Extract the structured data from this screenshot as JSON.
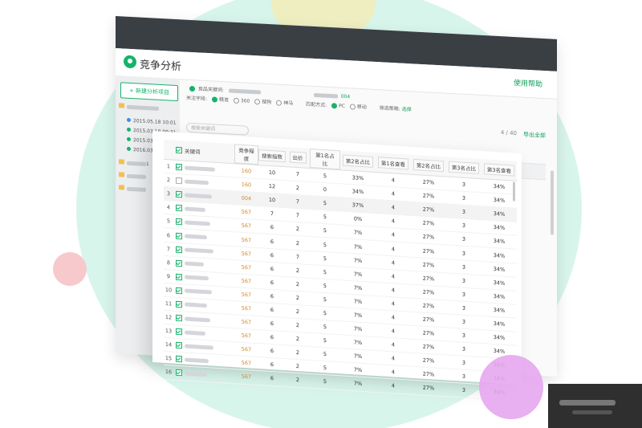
{
  "colors": {
    "accent": "#16b36a",
    "mint": "#d8f5ec",
    "titlebar": "#3a3f44",
    "search_col": "#d38a2c"
  },
  "back_window": {
    "app_title": "竞争分析",
    "help_link": "使用帮助",
    "new_button": "+ 新建分析项目",
    "tree": [
      {
        "kind": "group",
        "label": ""
      },
      {
        "kind": "time",
        "label": "2015.05.18 10:01"
      },
      {
        "kind": "time",
        "label": "2015.03.18 09:31"
      },
      {
        "kind": "time",
        "label": "2015.03.18 10:01"
      },
      {
        "kind": "time",
        "label": "2016.03.18 09:31"
      },
      {
        "kind": "folder",
        "label": "1"
      },
      {
        "kind": "folder",
        "label": ""
      },
      {
        "kind": "folder",
        "label": ""
      }
    ],
    "filter1_label": "竞品关键词:",
    "filter1_tag": "004",
    "filter2_label": "关注字段:",
    "filter2_opts": [
      "精准",
      "360",
      "搜狗",
      "神马"
    ],
    "filter3_label": "匹配方式:",
    "filter3_opts": [
      "PC",
      "移动"
    ],
    "filter4_label": "筛选策略:",
    "filter4_link": "选择",
    "search_placeholder": "搜索关键词",
    "count": "4 / 40",
    "export": "导出全部",
    "headers": [
      "关键词",
      "竞争程度",
      "搜索指数",
      "出价",
      "第1名占比",
      "第2名占比",
      "第3名占比",
      "第1名查看",
      "第2名占比"
    ]
  },
  "table": {
    "headers": [
      "关键词",
      "竞争程度",
      "搜索指数",
      "出价",
      "第1名占比",
      "第2名占比",
      "第1名查看",
      "第2名占比",
      "第3名占比",
      "第3名查看"
    ],
    "rows": [
      {
        "n": "1",
        "checked": true,
        "search": "160",
        "c1": "10",
        "c2": "7",
        "c3": "5",
        "p1": "33%",
        "q1": "4",
        "p2": "27%",
        "q2": "3",
        "p3": "34%",
        "hl": false
      },
      {
        "n": "2",
        "checked": false,
        "search": "160",
        "c1": "12",
        "c2": "2",
        "c3": "0",
        "p1": "34%",
        "q1": "4",
        "p2": "27%",
        "q2": "3",
        "p3": "34%",
        "hl": false
      },
      {
        "n": "3",
        "checked": true,
        "search": "004",
        "c1": "10",
        "c2": "7",
        "c3": "5",
        "p1": "37%",
        "q1": "4",
        "p2": "27%",
        "q2": "3",
        "p3": "34%",
        "hl": true
      },
      {
        "n": "4",
        "checked": true,
        "search": "567",
        "c1": "7",
        "c2": "7",
        "c3": "5",
        "p1": "0%",
        "q1": "4",
        "p2": "27%",
        "q2": "3",
        "p3": "34%",
        "hl": false
      },
      {
        "n": "5",
        "checked": true,
        "search": "567",
        "c1": "6",
        "c2": "2",
        "c3": "5",
        "p1": "7%",
        "q1": "4",
        "p2": "27%",
        "q2": "3",
        "p3": "34%",
        "hl": false
      },
      {
        "n": "6",
        "checked": true,
        "search": "567",
        "c1": "6",
        "c2": "2",
        "c3": "5",
        "p1": "7%",
        "q1": "4",
        "p2": "27%",
        "q2": "3",
        "p3": "34%",
        "hl": false
      },
      {
        "n": "7",
        "checked": true,
        "search": "567",
        "c1": "6",
        "c2": "7",
        "c3": "5",
        "p1": "7%",
        "q1": "4",
        "p2": "27%",
        "q2": "3",
        "p3": "34%",
        "hl": false
      },
      {
        "n": "8",
        "checked": true,
        "search": "567",
        "c1": "6",
        "c2": "2",
        "c3": "5",
        "p1": "7%",
        "q1": "4",
        "p2": "27%",
        "q2": "3",
        "p3": "34%",
        "hl": false
      },
      {
        "n": "9",
        "checked": true,
        "search": "567",
        "c1": "6",
        "c2": "2",
        "c3": "5",
        "p1": "7%",
        "q1": "4",
        "p2": "27%",
        "q2": "3",
        "p3": "34%",
        "hl": false
      },
      {
        "n": "10",
        "checked": true,
        "search": "567",
        "c1": "6",
        "c2": "2",
        "c3": "5",
        "p1": "7%",
        "q1": "4",
        "p2": "27%",
        "q2": "3",
        "p3": "34%",
        "hl": false
      },
      {
        "n": "11",
        "checked": true,
        "search": "567",
        "c1": "6",
        "c2": "2",
        "c3": "5",
        "p1": "7%",
        "q1": "4",
        "p2": "27%",
        "q2": "3",
        "p3": "34%",
        "hl": false
      },
      {
        "n": "12",
        "checked": true,
        "search": "567",
        "c1": "6",
        "c2": "2",
        "c3": "5",
        "p1": "7%",
        "q1": "4",
        "p2": "27%",
        "q2": "3",
        "p3": "34%",
        "hl": false
      },
      {
        "n": "13",
        "checked": true,
        "search": "567",
        "c1": "6",
        "c2": "2",
        "c3": "5",
        "p1": "7%",
        "q1": "4",
        "p2": "27%",
        "q2": "3",
        "p3": "34%",
        "hl": false
      },
      {
        "n": "14",
        "checked": true,
        "search": "567",
        "c1": "6",
        "c2": "2",
        "c3": "5",
        "p1": "7%",
        "q1": "4",
        "p2": "27%",
        "q2": "3",
        "p3": "34%",
        "hl": false
      },
      {
        "n": "15",
        "checked": true,
        "search": "567",
        "c1": "6",
        "c2": "2",
        "c3": "5",
        "p1": "7%",
        "q1": "4",
        "p2": "27%",
        "q2": "3",
        "p3": "34%",
        "hl": false
      },
      {
        "n": "16",
        "checked": true,
        "search": "567",
        "c1": "6",
        "c2": "2",
        "c3": "5",
        "p1": "7%",
        "q1": "4",
        "p2": "27%",
        "q2": "3",
        "p3": "34%",
        "hl": false
      }
    ]
  }
}
